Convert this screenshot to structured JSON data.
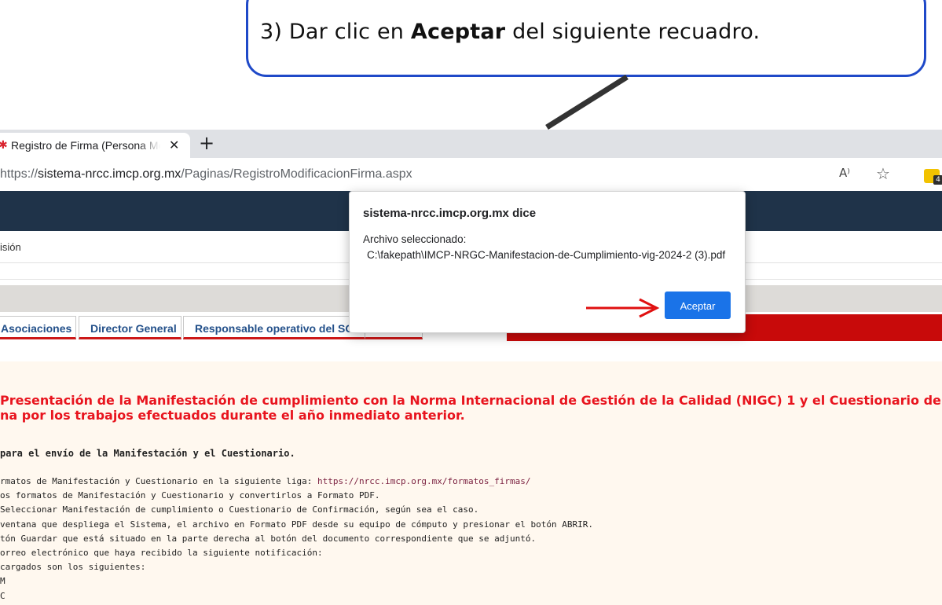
{
  "callout": {
    "prefix": "3) Dar clic en ",
    "bold": "Aceptar",
    "suffix": " del siguiente recuadro."
  },
  "browser": {
    "tab_title": "Registro de Firma (Persona Moral)",
    "tab_close": "✕",
    "new_tab": "+",
    "url_scheme": "https://",
    "url_host": "sistema-nrcc.imcp.org.mx",
    "url_path": "/Paginas/RegistroModificacionFirma.aspx",
    "read_aloud": "A⁾",
    "favorite": "☆",
    "extension_badge": "4"
  },
  "page": {
    "menu_item": "isión",
    "tabs": [
      {
        "label": "Asociaciones"
      },
      {
        "label": "Director General"
      },
      {
        "label": "Responsable operativo del SGC"
      }
    ],
    "heading_line1": "Presentación de la Manifestación de cumplimiento con la Norma Internacional de Gestión de la Calidad (NIGC) 1 y el Cuestionario de confirmación d",
    "heading_line2": "na por los trabajos efectuados durante el año inmediato anterior.",
    "subheading": "para el envío de la Manifestación y el Cuestionario.",
    "steps": [
      {
        "text": "rmatos de Manifestación y Cuestionario en la siguiente liga: ",
        "link": "https://nrcc.imcp.org.mx/formatos_firmas/"
      },
      {
        "text": "os formatos de Manifestación y Cuestionario y convertirlos a Formato PDF."
      },
      {
        "text": " Seleccionar Manifestación de cumplimiento o Cuestionario de Confirmación, según sea el caso."
      },
      {
        "text": " ventana que despliega el Sistema, el archivo en Formato PDF desde su equipo de cómputo y presionar el botón ABRIR."
      },
      {
        "text": "tón Guardar que está situado en la parte derecha al botón del documento correspondiente que se adjuntó."
      },
      {
        "text": "orreo electrónico que haya recibido la siguiente notificación:"
      },
      {
        "text": " cargados son los siguientes:"
      },
      {
        "text": "M"
      },
      {
        "text": "C"
      }
    ]
  },
  "dialog": {
    "title": "sistema-nrcc.imcp.org.mx dice",
    "message_label": "Archivo seleccionado:",
    "file_path": "C:\\fakepath\\IMCP-NRGC-Manifestacion-de-Cumplimiento-vig-2024-2 (3).pdf",
    "ok_label": "Aceptar"
  },
  "colors": {
    "callout_border": "#1f49c8",
    "nav_dark": "#1f3349",
    "accent_red": "#c80a0a",
    "heading_red": "#e8141e",
    "button_blue": "#1a73e8",
    "content_bg": "#fff8ef"
  }
}
